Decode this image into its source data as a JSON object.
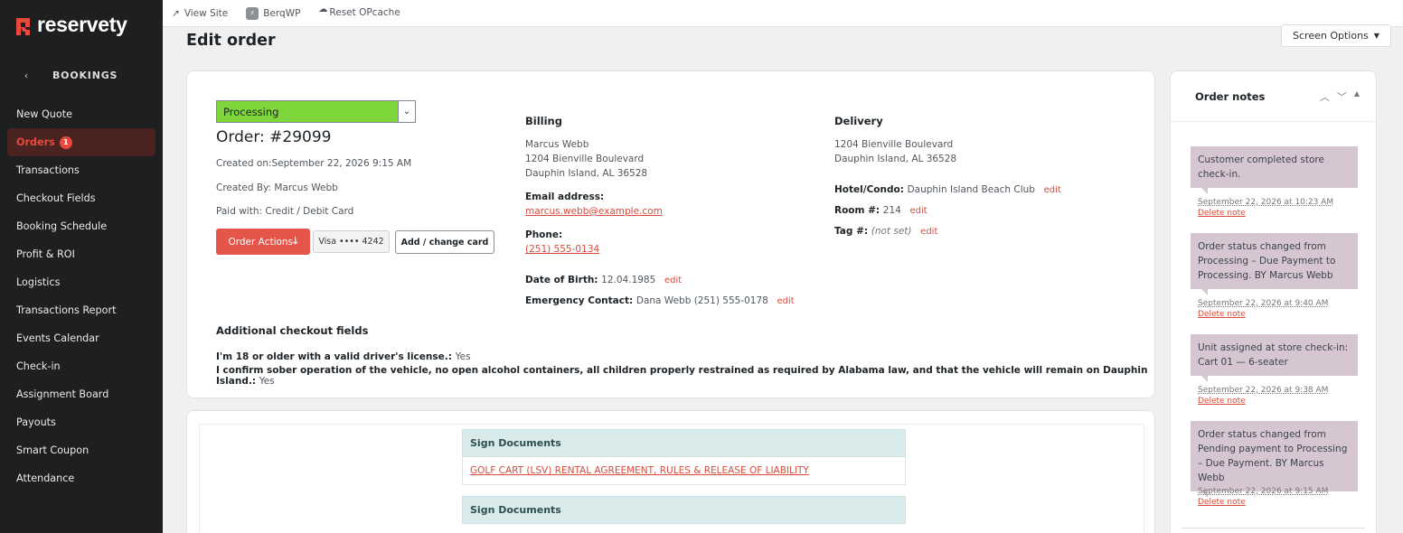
{
  "brand": {
    "name": "reservety",
    "accent": "#e8493c"
  },
  "sidebar": {
    "back_label": "BOOKINGS",
    "items": [
      {
        "label": "New Quote"
      },
      {
        "label": "Orders",
        "badge": "1",
        "active": true
      },
      {
        "label": "Transactions"
      },
      {
        "label": "Checkout Fields"
      },
      {
        "label": "Booking Schedule"
      },
      {
        "label": "Profit & ROI"
      },
      {
        "label": "Logistics"
      },
      {
        "label": "Transactions Report"
      },
      {
        "label": "Events Calendar"
      },
      {
        "label": "Check-in"
      },
      {
        "label": "Assignment Board"
      },
      {
        "label": "Payouts"
      },
      {
        "label": "Smart Coupon"
      },
      {
        "label": "Attendance"
      }
    ]
  },
  "topbar": {
    "view_site": "View Site",
    "berqwp": "BerqWP",
    "reset_opcache": "Reset OPcache"
  },
  "page": {
    "title": "Edit order",
    "screen_options": "Screen Options"
  },
  "order": {
    "status": "Processing",
    "status_color": "#7fd63b",
    "number": "Order: #29099",
    "created_on": "Created on:September 22, 2026 9:15 AM",
    "created_by": "Created By: Marcus Webb",
    "paid_with": "Paid with: Credit / Debit Card",
    "actions_label": "Order Actions",
    "card_label": "Visa •••• 4242",
    "change_card_label": "Add / change card"
  },
  "billing": {
    "heading": "Billing",
    "name": "Marcus Webb",
    "address1": "1204 Bienville Boulevard",
    "address2": "Dauphin Island, AL 36528",
    "email_label": "Email address:",
    "email": "marcus.webb@example.com",
    "phone_label": "Phone:",
    "phone": "(251) 555-0134",
    "dob_label": "Date of Birth:",
    "dob": "12.04.1985",
    "emergency_label": "Emergency Contact:",
    "emergency": "Dana Webb (251) 555-0178",
    "edit": "edit"
  },
  "delivery": {
    "heading": "Delivery",
    "address1": "1204 Bienville Boulevard",
    "address2": "Dauphin Island, AL 36528",
    "hotel_label": "Hotel/Condo:",
    "hotel": "Dauphin Island Beach Club",
    "room_label": "Room #:",
    "room": "214",
    "tag_label": "Tag #:",
    "tag": "(not set)",
    "edit": "edit"
  },
  "checkout_fields": {
    "heading": "Additional checkout fields",
    "fields": [
      {
        "label": "I'm 18 or older with a valid driver's license.:",
        "value": "Yes"
      },
      {
        "label": "I confirm sober operation of the vehicle, no open alcohol containers, all children properly restrained as required by Alabama law, and that the vehicle will remain on Dauphin Island.:",
        "value": "Yes"
      }
    ]
  },
  "documents": {
    "heading1": "Sign Documents",
    "link1": "GOLF CART (LSV) RENTAL AGREEMENT, RULES & RELEASE OF LIABILITY",
    "heading2": "Sign Documents"
  },
  "notes": {
    "title": "Order notes",
    "delete_label": "Delete note",
    "items": [
      {
        "text": "Customer completed store check-in.",
        "date": "September 22, 2026 at 10:23 AM"
      },
      {
        "text": "Order status changed from Processing – Due Payment to Processing. BY Marcus Webb",
        "date": "September 22, 2026 at 9:40 AM"
      },
      {
        "text": "Unit assigned at store check-in: Cart 01 — 6-seater",
        "date": "September 22, 2026 at 9:38 AM"
      },
      {
        "text": "Order status changed from Pending payment to Processing – Due Payment. BY Marcus Webb",
        "date": "September 22, 2026 at 9:15 AM"
      }
    ]
  }
}
